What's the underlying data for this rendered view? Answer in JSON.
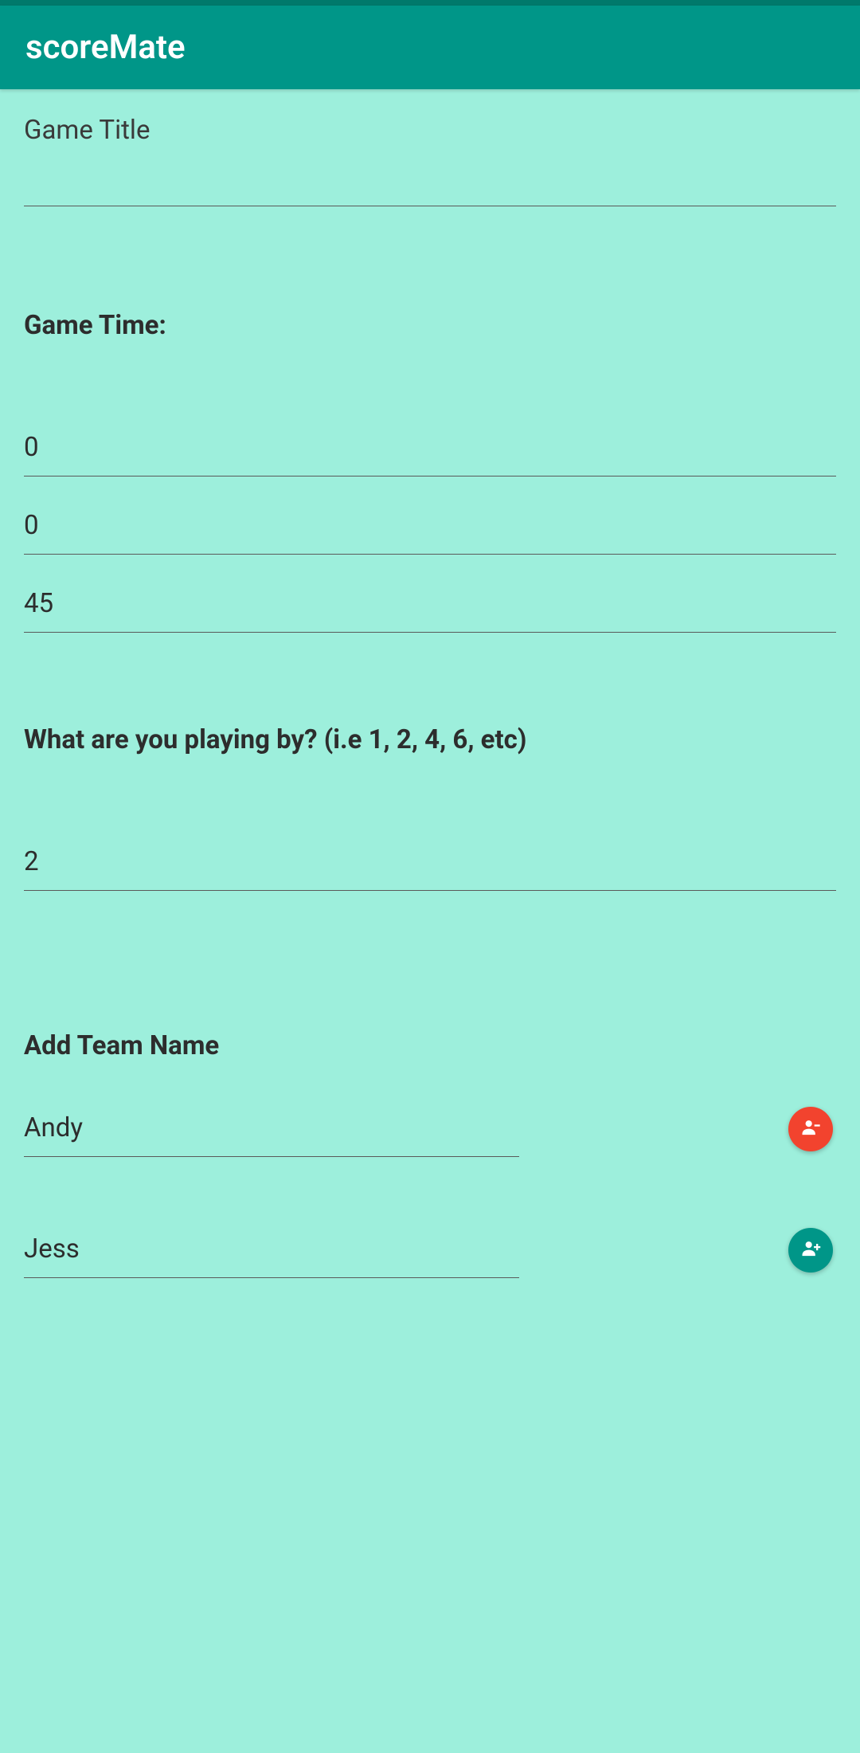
{
  "app": {
    "title": "scoreMate"
  },
  "gameTitle": {
    "label": "Game Title",
    "value": ""
  },
  "gameTime": {
    "label": "Game Time:",
    "value1": "0",
    "value2": "0",
    "value3": "45"
  },
  "playingBy": {
    "label": "What are you playing by? (i.e 1, 2, 4, 6, etc)",
    "value": "2"
  },
  "teamSection": {
    "label": "Add Team Name",
    "team1": "Andy",
    "team2": "Jess"
  }
}
